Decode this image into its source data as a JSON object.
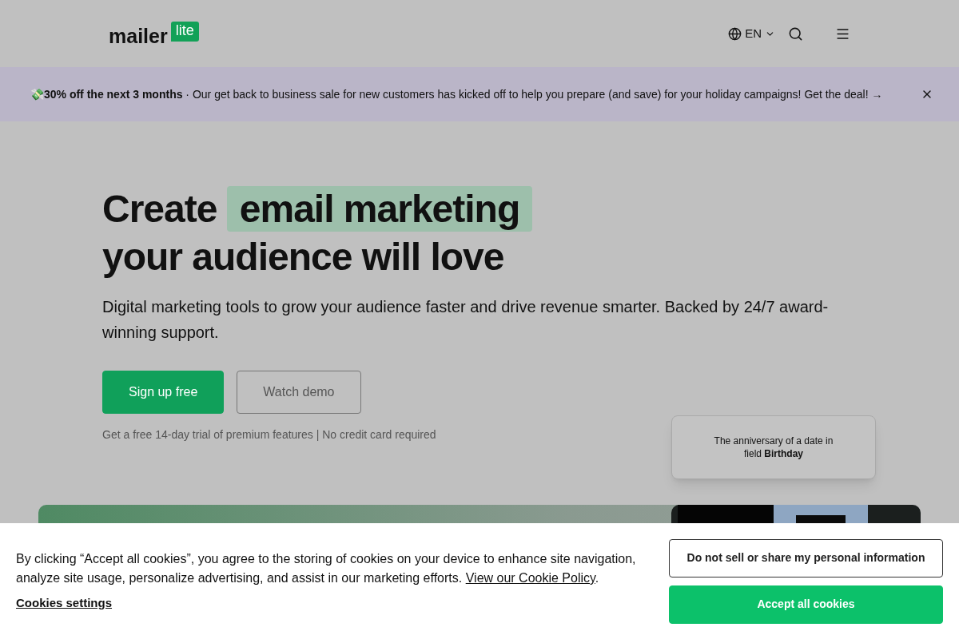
{
  "header": {
    "logo": {
      "word": "mailer",
      "badge": "lite"
    },
    "language": "EN"
  },
  "promo_banner": {
    "emoji": "💸",
    "headline": "30% off the next 3 months",
    "separator": "·",
    "message": "Our get back to business sale for new customers has kicked off to help you prepare (and save) for your holiday campaigns! Get the deal!",
    "arrow": "→"
  },
  "hero": {
    "title_start": "Create",
    "title_highlight": "email marketing",
    "title_end": "your audience will love",
    "subtitle": "Digital marketing tools to grow your audience faster and drive revenue smarter. Backed by 24/7 award-winning support.",
    "buttons": [
      {
        "label": "Sign up free",
        "kind": "primary"
      },
      {
        "label": "Watch demo",
        "kind": "secondary"
      }
    ],
    "note": "Get a free 14-day trial of premium features | No credit card required"
  },
  "automation_card": {
    "text": "The anniversary of a date in field **Birthday**"
  },
  "cookie_banner": {
    "message": "By clicking “Accept all cookies”, you agree to the storing of cookies on your device to enhance site navigation, analyze site usage, personalize advertising, and assist in our marketing efforts.",
    "policy_link": "View our Cookie Policy",
    "policy_end": ".",
    "settings_link": "Cookies settings",
    "buttons": [
      {
        "label": "Do not sell or share my personal information",
        "kind": "secondary"
      },
      {
        "label": "Accept all cookies",
        "kind": "primary"
      }
    ]
  }
}
